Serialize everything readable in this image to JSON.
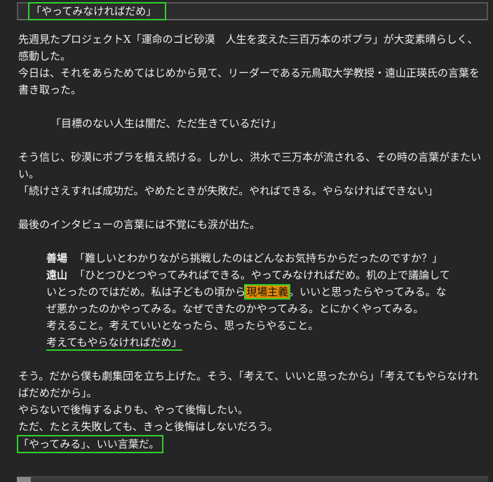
{
  "title": "「やってみなければだめ」",
  "paragraphs": {
    "p1": "先週見たプロジェクトX「運命のゴビ砂漠　人生を変えた三百万本のポプラ」が大変素晴らしく、感動した。",
    "p2": "今日は、それをあらためてはじめから見て、リーダーである元鳥取大学教授・遠山正瑛氏の言葉を書き取った。",
    "quote1": "「目標のない人生は闇だ、ただ生きているだけ」",
    "p3": "そう信じ、砂漠にポプラを植え続ける。しかし、洪水で三万本が流される、その時の言葉がまたいい。",
    "p4": "「続けさえすれば成功だ。やめたときが失敗だ。やればできる。やらなければできない」",
    "p5": "最後のインタビューの言葉には不覚にも涙が出た。",
    "speaker1": "善場",
    "line1": "「難しいとわかりながら挑戦したのはどんなお気持ちからだったのですか？」",
    "speaker2": "遠山",
    "line2a": "「ひとつひとつやってみればできる。やってみなければだめ。机の上で議論していとったのではだめ。私は子どもの頃から",
    "line2_mark": "現場主義",
    "line2b": "。いいと思ったらやってみる。なぜ悪かったのかやってみる。なぜできたのかやってみる。とにかくやってみる。",
    "line3a": "考えること。考えていいとなったら、思ったらやること。",
    "line3_underline": "考えてもやらなければだめ」",
    "p6": "そう。だから僕も劇集団を立ち上げた。そう、「考えて、いいと思ったから」「考えてもやらなければだめだから」。",
    "p7": "やらないで後悔するよりも、やって後悔したい。",
    "p8": "ただ、たとえ失敗しても、きっと後悔はしないだろう。",
    "closing": "「やってみる」、いい言葉だ。"
  },
  "colors": {
    "background": "#252525",
    "text": "#f0f0f0",
    "highlight_box": "#2ed12e",
    "highlight_fill": "#e58a00"
  }
}
